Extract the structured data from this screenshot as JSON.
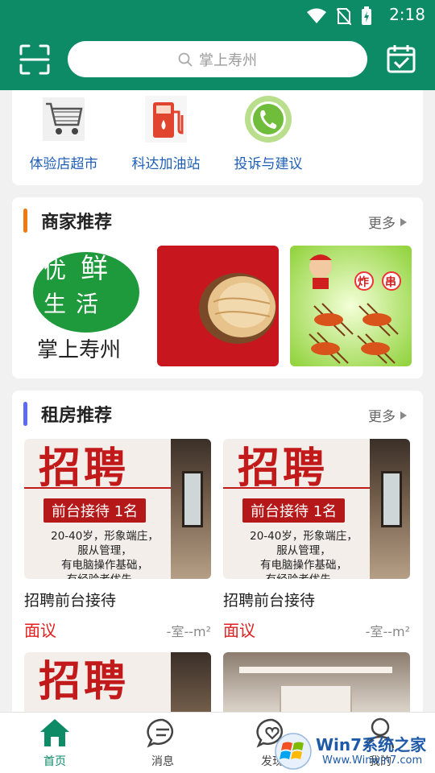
{
  "status_bar": {
    "time": "2:18"
  },
  "header": {
    "search_placeholder": "掌上寿州"
  },
  "quick_links": [
    {
      "label": "体验店超市",
      "icon": "shopping-cart-icon"
    },
    {
      "label": "科达加油站",
      "icon": "gas-pump-icon"
    },
    {
      "label": "投诉与建议",
      "icon": "phone-icon"
    }
  ],
  "merchants": {
    "title": "商家推荐",
    "more": "更多",
    "items": [
      {
        "image_text": [
          "优",
          "鲜",
          "生",
          "活"
        ],
        "caption": "掌上寿州"
      },
      {
        "image": "flatbread"
      },
      {
        "image_text": [
          "炸",
          "串"
        ]
      }
    ]
  },
  "rentals": {
    "title": "租房推荐",
    "more": "更多",
    "items": [
      {
        "title": "招聘前台接待",
        "price": "面议",
        "area": "-室--m²"
      },
      {
        "title": "招聘前台接待",
        "price": "面议",
        "area": "-室--m²"
      }
    ],
    "poster": {
      "headline": "招聘",
      "tag": "前台接待 1名",
      "lines": [
        "20-40岁，形象端庄，",
        "服从管理，",
        "有电脑操作基础，",
        "有经验者优先，"
      ]
    }
  },
  "tabbar": {
    "tabs": [
      {
        "label": "首页",
        "active": true
      },
      {
        "label": "消息",
        "active": false
      },
      {
        "label": "发现",
        "active": false
      },
      {
        "label": "我的",
        "active": false
      }
    ]
  },
  "watermark": {
    "line1": "Win7系统之家",
    "line2": "Www.Winwin7.com"
  },
  "colors": {
    "brand": "#0d8a66",
    "accent_orange": "#f07a12",
    "accent_blue": "#5b6cf2",
    "price_red": "#e02020"
  }
}
